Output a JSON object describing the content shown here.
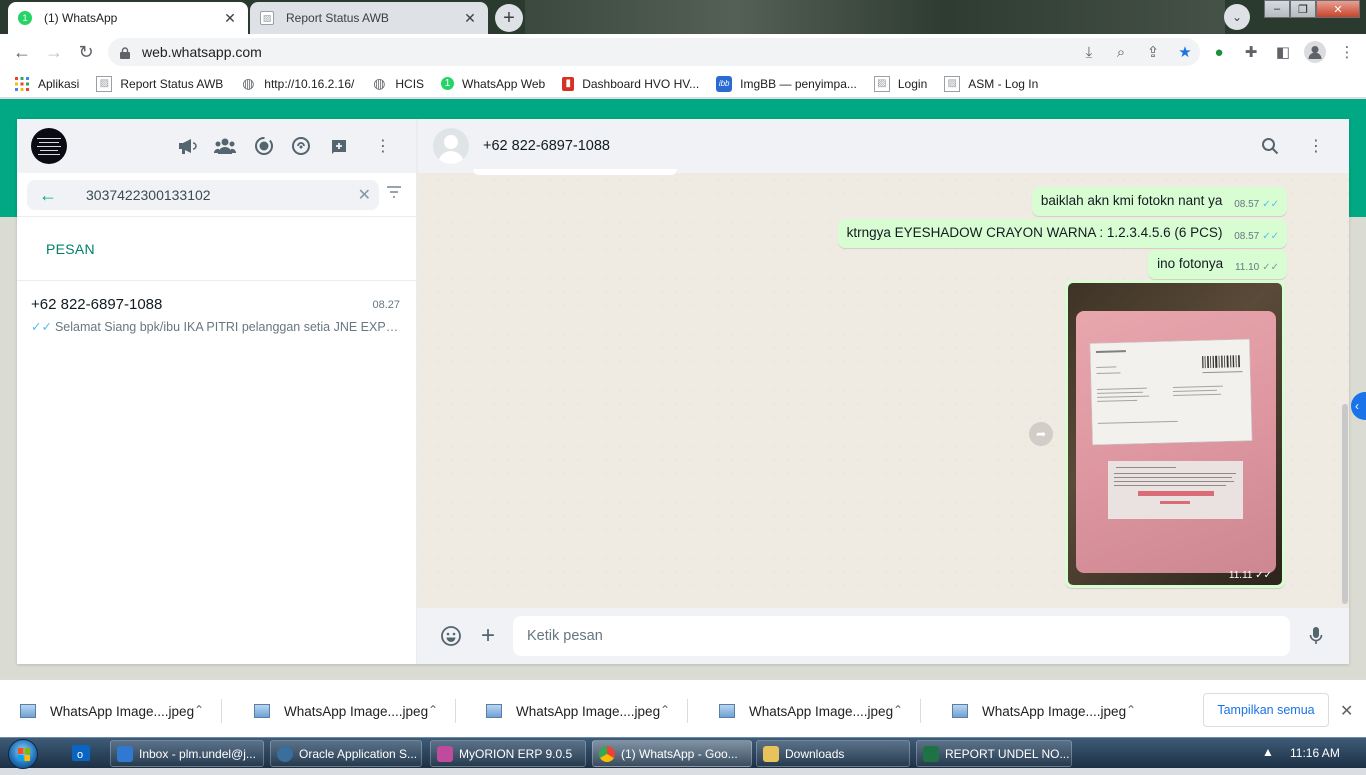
{
  "browser": {
    "tabs": [
      {
        "title": "(1) WhatsApp",
        "active": true
      },
      {
        "title": "Report Status AWB",
        "active": false
      }
    ],
    "url": "web.whatsapp.com",
    "bookmarks": [
      {
        "label": "Aplikasi",
        "icon": "apps-grid-icon"
      },
      {
        "label": "Report Status AWB",
        "icon": "page-icon"
      },
      {
        "label": "http://10.16.2.16/",
        "icon": "globe-icon"
      },
      {
        "label": "HCIS",
        "icon": "globe-icon"
      },
      {
        "label": "WhatsApp Web",
        "icon": "whatsapp-icon"
      },
      {
        "label": "Dashboard HVO HV...",
        "icon": "dashboard-icon"
      },
      {
        "label": "ImgBB — penyimpa...",
        "icon": "imgbb-icon"
      },
      {
        "label": "Login",
        "icon": "page-icon"
      },
      {
        "label": "ASM - Log In",
        "icon": "page-icon"
      }
    ]
  },
  "whatsapp": {
    "search": {
      "value": "3037422300133102"
    },
    "section_label": "PESAN",
    "chat_result": {
      "name": "+62 822-6897-1088",
      "time": "08.27",
      "snippet": "Selamat Siang   bpk/ibu IKA PITRI pelanggan setia JNE EXPR..."
    },
    "conversation": {
      "contact": "+62 822-6897-1088",
      "messages": [
        {
          "text": "baiklah akn kmi fotokn nant ya",
          "time": "08.57",
          "read": true
        },
        {
          "text": "ktrngya EYESHADOW CRAYON WARNA : 1.2.3.4.5.6 (6 PCS)",
          "time": "08.57",
          "read": true
        },
        {
          "text": "ino fotonya",
          "time": "11.10",
          "read": false
        }
      ],
      "image_message": {
        "time": "11.11",
        "read": false
      },
      "composer_placeholder": "Ketik pesan"
    }
  },
  "downloads": {
    "items": [
      "WhatsApp Image....jpeg",
      "WhatsApp Image....jpeg",
      "WhatsApp Image....jpeg",
      "WhatsApp Image....jpeg",
      "WhatsApp Image....jpeg"
    ],
    "show_all": "Tampilkan semua"
  },
  "taskbar": {
    "tasks": [
      {
        "label": "Inbox - plm.undel@j...",
        "active": false
      },
      {
        "label": "Oracle Application S...",
        "active": false
      },
      {
        "label": "MyORION ERP 9.0.5",
        "active": false
      },
      {
        "label": "(1) WhatsApp - Goo...",
        "active": true
      },
      {
        "label": "Downloads",
        "active": false
      },
      {
        "label": "REPORT UNDEL NO...",
        "active": false
      }
    ],
    "clock": "11:16 AM"
  },
  "colors": {
    "whatsapp_green": "#00a884",
    "outgoing_bubble": "#d9fdd3",
    "read_tick": "#53bdeb",
    "link_blue": "#1a73e8"
  }
}
